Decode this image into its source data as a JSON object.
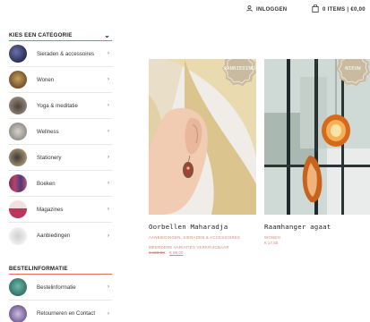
{
  "header": {
    "login_label": "INLOGGEN",
    "cart_label": "0 ITEMS | €0,00"
  },
  "sidebar": {
    "category_heading": "KIES EEN CATEGORIE",
    "categories": [
      {
        "label": "Sieraden & accessoires"
      },
      {
        "label": "Wonen"
      },
      {
        "label": "Yoga & meditatie"
      },
      {
        "label": "Wellness"
      },
      {
        "label": "Stationery"
      },
      {
        "label": "Boeken"
      },
      {
        "label": "Magazines"
      },
      {
        "label": "Aanbiedingen"
      }
    ],
    "order_heading": "BESTELINFORMATIE",
    "order_items": [
      {
        "label": "Bestelinformatie"
      },
      {
        "label": "Retourneren en Contact"
      }
    ]
  },
  "products": [
    {
      "badge": "AANBIEDING",
      "name": "Oorbellen Maharadja",
      "categories": "AANBIEDINGEN, SIERADEN & ACCESSOIRES",
      "note": "MEERDERE VARIATIES VERKRIJGBAAR",
      "old_price": "€ 120,00",
      "price": "€ 99,00"
    },
    {
      "badge": "NIEUW",
      "name": "Raamhanger agaat",
      "categories": "WONEN",
      "price": "€ 17,50"
    }
  ],
  "colors": {
    "accent": "#e06f5f",
    "badge": "#c9bba0",
    "price": "#d08a7c"
  }
}
